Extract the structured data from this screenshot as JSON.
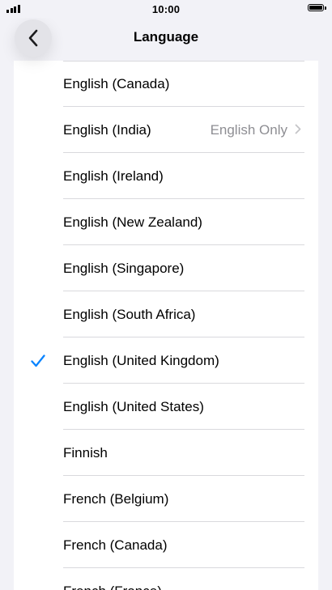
{
  "status_bar": {
    "time": "10:00"
  },
  "nav": {
    "title": "Language",
    "back_icon": "chevron-left-icon"
  },
  "languages": [
    {
      "label": "English (Canada)",
      "detail": "",
      "selected": false
    },
    {
      "label": "English (India)",
      "detail": "English Only",
      "selected": false
    },
    {
      "label": "English (Ireland)",
      "detail": "",
      "selected": false
    },
    {
      "label": "English (New Zealand)",
      "detail": "",
      "selected": false
    },
    {
      "label": "English (Singapore)",
      "detail": "",
      "selected": false
    },
    {
      "label": "English (South Africa)",
      "detail": "",
      "selected": false
    },
    {
      "label": "English (United Kingdom)",
      "detail": "",
      "selected": true
    },
    {
      "label": "English (United States)",
      "detail": "",
      "selected": false
    },
    {
      "label": "Finnish",
      "detail": "",
      "selected": false
    },
    {
      "label": "French (Belgium)",
      "detail": "",
      "selected": false
    },
    {
      "label": "French (Canada)",
      "detail": "",
      "selected": false
    },
    {
      "label": "French (France)",
      "detail": "",
      "selected": false
    }
  ],
  "colors": {
    "accent": "#0a84ff",
    "secondary_text": "#8e8e93",
    "background": "#f2f2f7",
    "card": "#ffffff"
  }
}
